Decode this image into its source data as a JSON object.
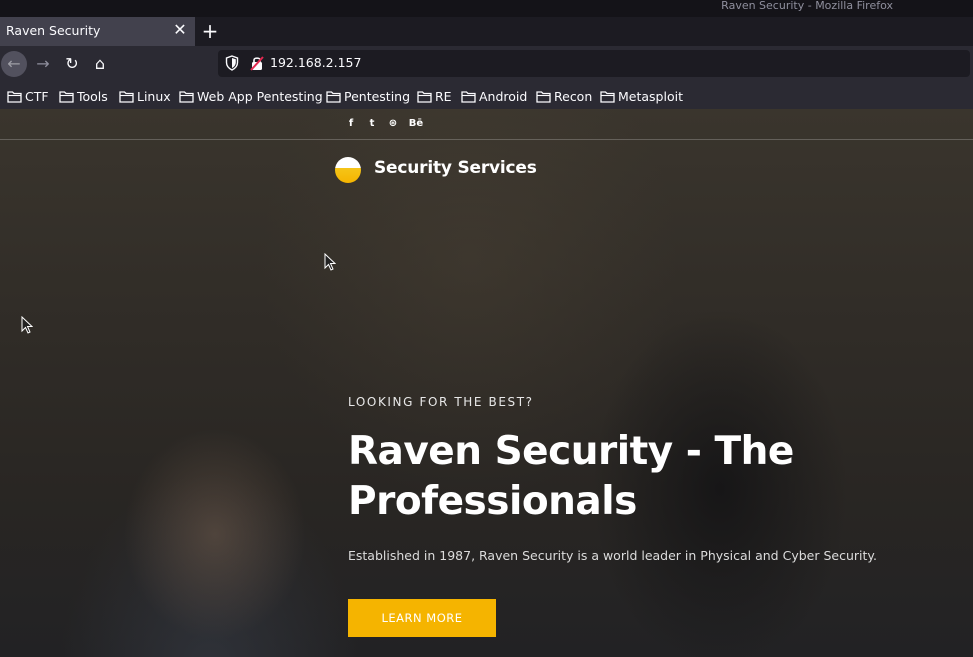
{
  "window": {
    "title": "Raven Security - Mozilla Firefox"
  },
  "tab": {
    "label": "Raven Security",
    "close_glyph": "✕",
    "new_tab_glyph": "+"
  },
  "nav": {
    "back_glyph": "←",
    "forward_glyph": "→",
    "reload_glyph": "↻",
    "home_glyph": "⌂",
    "url": "192.168.2.157"
  },
  "bookmarks": [
    "CTF",
    "Tools",
    "Linux",
    "Web App Pentesting",
    "Pentesting",
    "RE",
    "Android",
    "Recon",
    "Metasploit"
  ],
  "site": {
    "social": [
      "f",
      "t",
      "⊛",
      "Bē"
    ],
    "brand": "Security Services",
    "kicker": "LOOKING FOR THE BEST?",
    "headline": "Raven Security - The Professionals",
    "description": "Established in 1987, Raven Security is a world leader in Physical and Cyber Security.",
    "cta_label": "LEARN MORE"
  },
  "colors": {
    "accent": "#f5b400",
    "chrome_dark": "#1c1b22",
    "chrome": "#2b2a33",
    "tab_active": "#42414d"
  },
  "icons": [
    "shield-icon",
    "insecure-lock-icon",
    "folder-icon",
    "facebook-icon",
    "twitter-icon",
    "dribbble-icon",
    "behance-icon"
  ]
}
